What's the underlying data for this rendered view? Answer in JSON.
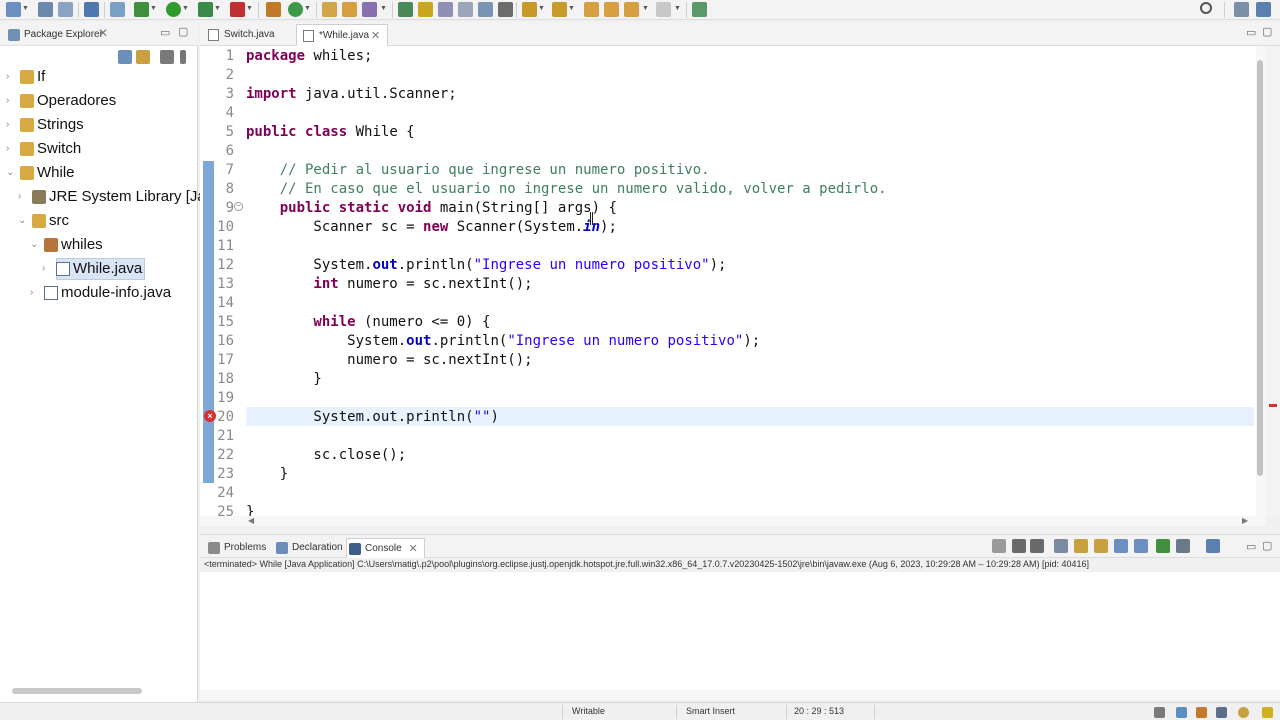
{
  "package_explorer": {
    "tab_label": "Package Explorer",
    "tree": [
      {
        "label": "If",
        "type": "project"
      },
      {
        "label": "Operadores",
        "type": "project"
      },
      {
        "label": "Strings",
        "type": "project"
      },
      {
        "label": "Switch",
        "type": "project"
      },
      {
        "label": "While",
        "type": "project"
      },
      {
        "label": "JRE System Library [Ja",
        "type": "library"
      },
      {
        "label": "src",
        "type": "folder"
      },
      {
        "label": "whiles",
        "type": "package"
      },
      {
        "label": "While.java",
        "type": "java-file"
      },
      {
        "label": "module-info.java",
        "type": "java-file"
      }
    ]
  },
  "editor": {
    "tabs": [
      {
        "label": "Switch.java"
      },
      {
        "label": "*While.java"
      }
    ],
    "line_numbers": [
      "1",
      "2",
      "3",
      "4",
      "5",
      "6",
      "7",
      "8",
      "9",
      "10",
      "11",
      "12",
      "13",
      "14",
      "15",
      "16",
      "17",
      "18",
      "19",
      "20",
      "21",
      "22",
      "23",
      "24",
      "25"
    ],
    "code": {
      "l1_kw": "package",
      "l1_rest": " whiles;",
      "l3_kw": "import",
      "l3_rest": " java.util.Scanner;",
      "l5_kw1": "public",
      "l5_kw2": "class",
      "l5_rest": " While {",
      "l7": "    // Pedir al usuario que ingrese un numero positivo.",
      "l8": "    // En caso que el usuario no ingrese un numero valido, volver a pedirlo.",
      "l9_kw": "    public static void",
      "l9_rest": " main(String[] args) {",
      "l10_a": "        Scanner sc = ",
      "l10_kw": "new",
      "l10_b": " Scanner(System.",
      "l10_fld": "in",
      "l10_c": ");",
      "l12_a": "        System.",
      "l12_fld": "out",
      "l12_b": ".println(",
      "l12_str": "\"Ingrese un numero positivo\"",
      "l12_c": ");",
      "l13_kw": "        int",
      "l13_rest": " numero = sc.nextInt();",
      "l15_kw": "        while",
      "l15_rest": " (numero <= 0) {",
      "l16_a": "            System.",
      "l16_fld": "out",
      "l16_b": ".println(",
      "l16_str": "\"Ingrese un numero positivo\"",
      "l16_c": ");",
      "l17": "            numero = sc.nextInt();",
      "l18": "        }",
      "l20_a": "        System.out.println(",
      "l20_str": "\"\"",
      "l20_c": ")",
      "l22": "        sc.close();",
      "l23": "    }",
      "l25": "}"
    }
  },
  "console": {
    "tabs": [
      {
        "label": "Problems"
      },
      {
        "label": "Declaration"
      },
      {
        "label": "Console"
      }
    ],
    "description": "<terminated> While [Java Application] C:\\Users\\matig\\.p2\\pool\\plugins\\org.eclipse.justj.openjdk.hotspot.jre.full.win32.x86_64_17.0.7.v20230425-1502\\jre\\bin\\javaw.exe  (Aug 6, 2023, 10:29:28 AM – 10:29:28 AM) [pid: 40416]"
  },
  "statusbar": {
    "writable": "Writable",
    "insert_mode": "Smart Insert",
    "position": "20 : 29 : 513"
  },
  "colors": {
    "keyword": "#7f0055",
    "comment": "#3f7f5f",
    "string": "#2a00ff",
    "field": "#0000c0",
    "error": "#d9312b"
  }
}
